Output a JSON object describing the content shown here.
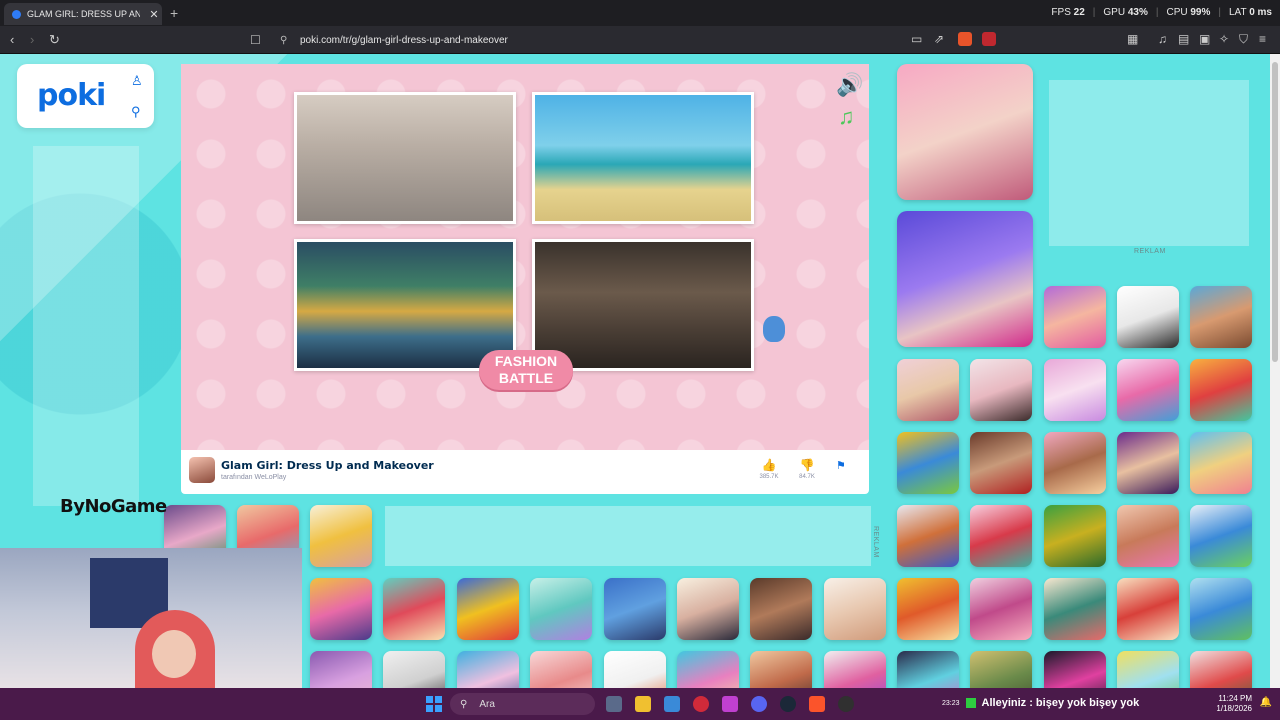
{
  "browser": {
    "tab_title": "GLAM GIRL: DRESS UP AND MAKE",
    "url": "poki.com/tr/g/glam-girl-dress-up-and-makeover",
    "perf": {
      "fps_label": "FPS",
      "fps_value": "22",
      "gpu_label": "GPU",
      "gpu_value": "43%",
      "cpu_label": "CPU",
      "cpu_value": "99%",
      "lat_label": "LAT",
      "lat_value": "0 ms"
    }
  },
  "site": {
    "logo": "poki"
  },
  "game": {
    "fashion_button": "FASHION BATTLE",
    "title": "Glam Girl: Dress Up and Makeover",
    "author": "tarafından WeLoPlay",
    "likes": "385.7K",
    "dislikes": "84.7K"
  },
  "ads": {
    "label_right": "REKLAM",
    "label_mid": "REKLAM"
  },
  "overlay": {
    "brand": "ByNoGame"
  },
  "taskbar": {
    "search_placeholder": "Ara",
    "ticker_time": "23:23",
    "ticker_text": "Alleyiniz : bişey yok bişey yok",
    "clock_time": "11:24 PM",
    "clock_date": "1/18/2026"
  },
  "colors": {
    "accent": "#0d6de0",
    "page_bg": "#5ee3e2",
    "frame_bg": "#f4c5d4",
    "button_pink": "#f08aa6",
    "taskbar": "#4a1a4a"
  }
}
